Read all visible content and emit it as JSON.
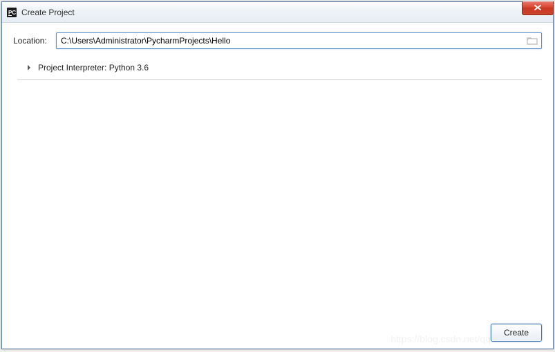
{
  "window": {
    "title": "Create Project"
  },
  "form": {
    "location_label": "Location:",
    "location_value": "C:\\Users\\Administrator\\PycharmProjects\\Hello",
    "interpreter_label": "Project Interpreter: Python 3.6"
  },
  "footer": {
    "create_label": "Create"
  },
  "watermark": "https://blog.csdn.net/qq"
}
